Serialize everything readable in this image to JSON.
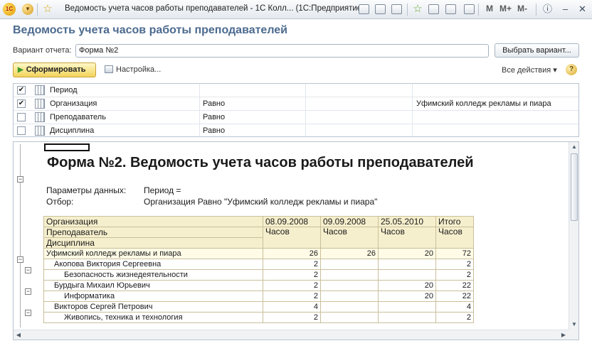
{
  "window": {
    "title": "Ведомость учета часов работы преподавателей - 1С Колл...  (1С:Предприятие)",
    "logo_text": "1С",
    "mem_buttons": [
      "M",
      "M+",
      "M-"
    ]
  },
  "header": {
    "form_title": "Ведомость учета часов работы преподавателей",
    "variant_label": "Вариант отчета:",
    "variant_value": "Форма №2",
    "select_variant_button": "Выбрать вариант...",
    "generate_button": "Сформировать",
    "settings_link": "Настройка...",
    "all_actions": "Все действия ▾",
    "help": "?"
  },
  "filters": [
    {
      "checked": true,
      "name": "Период",
      "condition": "",
      "value": ""
    },
    {
      "checked": true,
      "name": "Организация",
      "condition": "Равно",
      "value": "Уфимский колледж рекламы и пиара"
    },
    {
      "checked": false,
      "name": "Преподаватель",
      "condition": "Равно",
      "value": ""
    },
    {
      "checked": false,
      "name": "Дисциплина",
      "condition": "Равно",
      "value": ""
    }
  ],
  "report": {
    "title": "Форма №2. Ведомость учета часов работы преподавателей",
    "params_label": "Параметры данных:",
    "params_value": "Период =",
    "filter_label": "Отбор:",
    "filter_value": "Организация Равно \"Уфимский колледж рекламы и пиара\"",
    "table": {
      "dim_headers": [
        "Организация",
        "Преподаватель",
        "Дисциплина"
      ],
      "dates": [
        "08.09.2008",
        "09.09.2008",
        "25.05.2010"
      ],
      "total_header": "Итого",
      "unit_header": "Часов",
      "rows": [
        {
          "level": 0,
          "label": "Уфимский колледж рекламы и пиара",
          "values": [
            "26",
            "26",
            "20",
            "72"
          ]
        },
        {
          "level": 1,
          "label": "Акопова Виктория Сергеевна",
          "values": [
            "2",
            "",
            "",
            "2"
          ]
        },
        {
          "level": 2,
          "label": "Безопасность жизнедеятельности",
          "values": [
            "2",
            "",
            "",
            "2"
          ]
        },
        {
          "level": 1,
          "label": "Бурдыга Михаил Юрьевич",
          "values": [
            "2",
            "",
            "20",
            "22"
          ]
        },
        {
          "level": 2,
          "label": "Информатика",
          "values": [
            "2",
            "",
            "20",
            "22"
          ]
        },
        {
          "level": 1,
          "label": "Викторов Сергей Петрович",
          "values": [
            "4",
            "",
            "",
            "4"
          ]
        },
        {
          "level": 2,
          "label": "Живопись, техника и технология",
          "values": [
            "2",
            "",
            "",
            "2"
          ]
        }
      ]
    }
  },
  "colors": {
    "form_title": "#4c6a8f",
    "header_cell_bg": "#f6efcd",
    "generate_button_bg": "#f2d35a"
  }
}
